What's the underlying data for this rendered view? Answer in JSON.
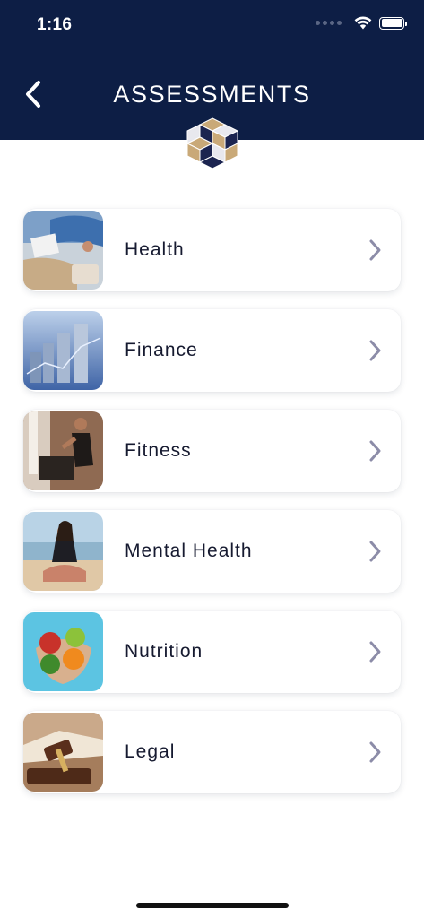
{
  "status_bar": {
    "time": "1:16"
  },
  "header": {
    "title": "ASSESSMENTS"
  },
  "colors": {
    "header_bg": "#0d1e45",
    "chevron": "#8c8ca8",
    "text": "#161a30"
  },
  "items": [
    {
      "label": "Health",
      "image": "health-photo"
    },
    {
      "label": "Finance",
      "image": "finance-photo"
    },
    {
      "label": "Fitness",
      "image": "fitness-photo"
    },
    {
      "label": "Mental Health",
      "image": "mental-health-photo"
    },
    {
      "label": "Nutrition",
      "image": "nutrition-photo"
    },
    {
      "label": "Legal",
      "image": "legal-photo"
    }
  ]
}
